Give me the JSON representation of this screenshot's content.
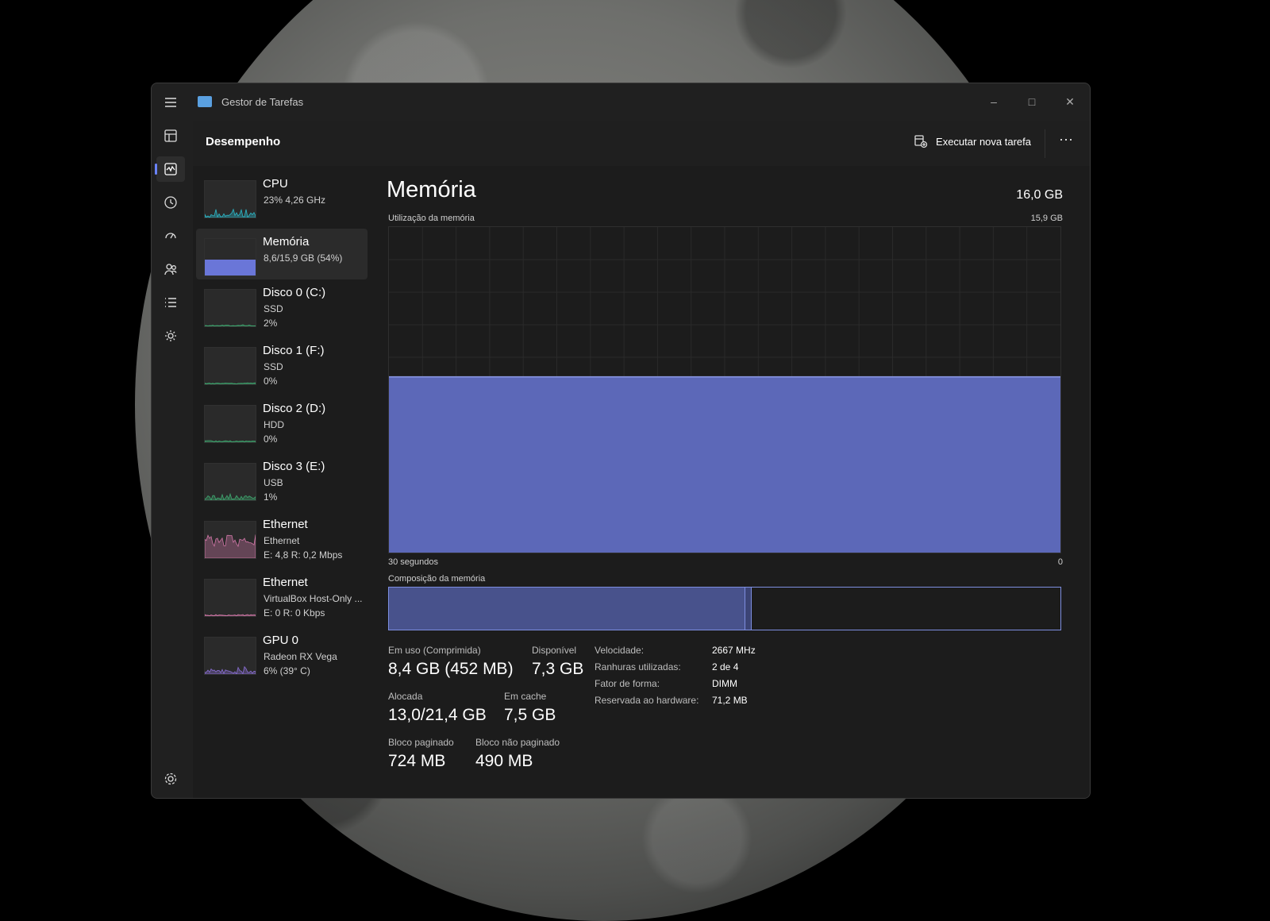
{
  "window": {
    "title": "Gestor de Tarefas",
    "controls": {
      "minimize": "–",
      "maximize": "□",
      "close": "✕"
    }
  },
  "rail": {
    "items": [
      {
        "icon": "processes-icon"
      },
      {
        "icon": "performance-icon",
        "active": true
      },
      {
        "icon": "app-history-icon"
      },
      {
        "icon": "startup-apps-icon"
      },
      {
        "icon": "users-icon"
      },
      {
        "icon": "details-icon"
      },
      {
        "icon": "services-icon"
      }
    ],
    "settings_icon": "gear-icon"
  },
  "header": {
    "title": "Desempenho",
    "run_task_label": "Executar nova tarefa",
    "more_label": "⋯"
  },
  "devices": [
    {
      "name": "CPU",
      "sub1": "23%  4,26 GHz",
      "sub2": "",
      "color": "#2bb8c8",
      "type": "spark"
    },
    {
      "name": "Memória",
      "sub1": "8,6/15,9 GB (54%)",
      "sub2": "",
      "color": "#6a76d8",
      "type": "fill",
      "selected": true
    },
    {
      "name": "Disco 0 (C:)",
      "sub1": "SSD",
      "sub2": "2%",
      "color": "#3fa870",
      "type": "flat"
    },
    {
      "name": "Disco 1 (F:)",
      "sub1": "SSD",
      "sub2": "0%",
      "color": "#3fa870",
      "type": "flat"
    },
    {
      "name": "Disco 2 (D:)",
      "sub1": "HDD",
      "sub2": "0%",
      "color": "#3fa870",
      "type": "flat"
    },
    {
      "name": "Disco 3 (E:)",
      "sub1": "USB",
      "sub2": "1%",
      "color": "#3fa870",
      "type": "spark"
    },
    {
      "name": "Ethernet",
      "sub1": "Ethernet",
      "sub2": "E: 4,8  R: 0,2 Mbps",
      "color": "#d277a8",
      "type": "noisy"
    },
    {
      "name": "Ethernet",
      "sub1": "VirtualBox Host-Only ...",
      "sub2": "E: 0  R: 0 Kbps",
      "color": "#d277a8",
      "type": "flat"
    },
    {
      "name": "GPU 0",
      "sub1": "Radeon RX Vega",
      "sub2": "6%  (39° C)",
      "color": "#8b6fd6",
      "type": "spark"
    }
  ],
  "memory": {
    "title": "Memória",
    "total": "16,0 GB",
    "usage_label": "Utilização da memória",
    "usage_max": "15,9 GB",
    "time_left": "30 segundos",
    "time_right": "0",
    "usage_fraction": 0.54,
    "composition_label": "Composição da memória",
    "composition_used_fraction": 0.53,
    "composition_modified_fraction": 0.01,
    "fill_color": "#5c68b8",
    "stats": {
      "in_use_label": "Em uso (Comprimida)",
      "in_use_value": "8,4 GB (452 MB)",
      "available_label": "Disponível",
      "available_value": "7,3 GB",
      "committed_label": "Alocada",
      "committed_value": "13,0/21,4 GB",
      "cached_label": "Em cache",
      "cached_value": "7,5 GB",
      "paged_label": "Bloco paginado",
      "paged_value": "724 MB",
      "nonpaged_label": "Bloco não paginado",
      "nonpaged_value": "490 MB"
    },
    "specs": [
      {
        "key": "Velocidade:",
        "value": "2667 MHz"
      },
      {
        "key": "Ranhuras utilizadas:",
        "value": "2 de 4"
      },
      {
        "key": "Fator de forma:",
        "value": "DIMM"
      },
      {
        "key": "Reservada ao hardware:",
        "value": "71,2 MB"
      }
    ]
  }
}
